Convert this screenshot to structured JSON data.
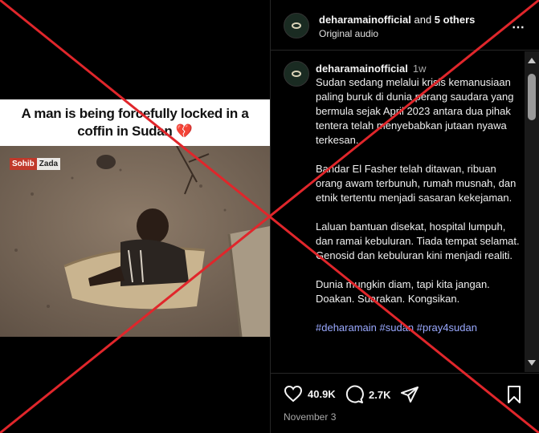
{
  "video": {
    "caption_line1": "A man is being forcefully locked in a",
    "caption_line2": "coffin in Sudan",
    "caption_emoji": "💔",
    "watermark_a": "Sohib",
    "watermark_b": "Zada"
  },
  "header": {
    "username": "deharamainofficial",
    "collab_suffix": " and ",
    "collab_others": "5 others",
    "audio": "Original audio",
    "more_icon": "⋯"
  },
  "caption": {
    "username": "deharamainofficial",
    "time": "1w",
    "paragraphs": [
      "Sudan sedang melalui krisis kemanusiaan paling buruk di dunia perang saudara yang bermula sejak April 2023 antara dua pihak tentera telah menyebabkan jutaan nyawa terkesan.",
      "Bandar El Fasher telah ditawan, ribuan orang awam terbunuh, rumah musnah, dan etnik tertentu menjadi sasaran kekejaman.",
      "Laluan bantuan disekat, hospital lumpuh, dan ramai kebuluran. Tiada tempat selamat. Genosid dan kebuluran kini menjadi realiti.",
      "Dunia mungkin diam, tapi kita jangan. Doakan. Suarakan. Kongsikan."
    ],
    "hashtags": "#deharamain #sudan #pray4sudan"
  },
  "actions": {
    "likes": "40.9K",
    "comments": "2.7K",
    "date": "November 3"
  },
  "colors": {
    "overlay_red": "#e0262b",
    "hashtag": "#9aa9ff"
  }
}
